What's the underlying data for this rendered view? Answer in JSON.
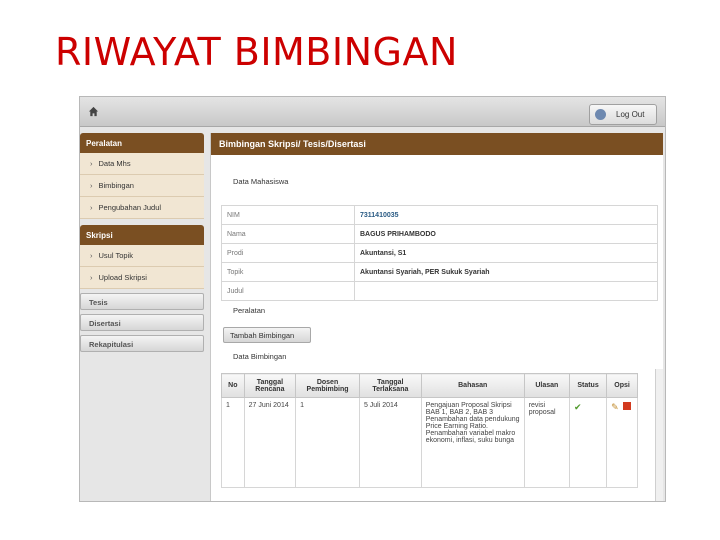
{
  "slide": {
    "title": "RIWAYAT BIMBINGAN"
  },
  "topbar": {
    "logout_label": "Log Out"
  },
  "sidebar": {
    "peralatan_title": "Peralatan",
    "peralatan_items": [
      "Data Mhs",
      "Bimbingan",
      "Pengubahan Judul"
    ],
    "skripsi_title": "Skripsi",
    "skripsi_items": [
      "Usul Topik",
      "Upload Skripsi"
    ],
    "buttons": [
      "Tesis",
      "Disertasi",
      "Rekapitulasi"
    ]
  },
  "content": {
    "header": "Bimbingan Skripsi/ Tesis/Disertasi",
    "data_mahasiswa_label": "Data Mahasiswa",
    "info": [
      {
        "label": "NIM",
        "value": "7311410035"
      },
      {
        "label": "Nama",
        "value": "BAGUS PRIHAMBODO"
      },
      {
        "label": "Prodi",
        "value": "Akuntansi, S1"
      },
      {
        "label": "Topik",
        "value": "Akuntansi Syariah, PER Sukuk Syariah"
      },
      {
        "label": "Judul",
        "value": ""
      }
    ],
    "peralatan_label": "Peralatan",
    "tambah_button": "Tambah Bimbingan",
    "data_bimbingan_label": "Data Bimbingan",
    "table": {
      "headers": [
        "No",
        "Tanggal Rencana",
        "Dosen Pembimbing",
        "Tanggal Terlaksana",
        "Bahasan",
        "Ulasan",
        "Status",
        "Opsi"
      ],
      "rows": [
        {
          "no": "1",
          "tanggal_rencana": "27 Juni 2014",
          "dosen": "1",
          "tanggal_terlaksana": "5 Juli 2014",
          "bahasan": "Pengajuan Proposal Skripsi BAB 1, BAB 2, BAB 3 Penambahan data pendukung Price Earning Ratio. Penambahan variabel makro ekonomi, inflasi, suku bunga",
          "ulasan": "revisi proposal"
        }
      ]
    }
  },
  "colors": {
    "title": "#cc0000",
    "header_brown": "#7a4f22",
    "sidebar_item_bg": "#f1e6d3",
    "nim_blue": "#2a5b84"
  }
}
